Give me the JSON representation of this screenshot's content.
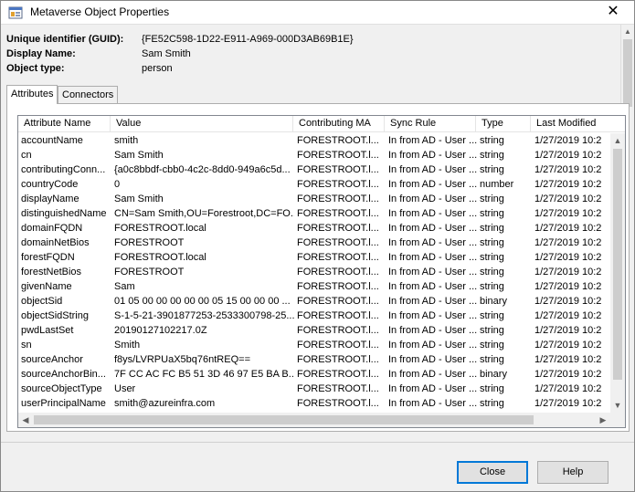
{
  "window": {
    "title": "Metaverse Object Properties",
    "close_glyph": "✕"
  },
  "info": {
    "guid_label": "Unique identifier (GUID):",
    "guid_value": "{FE52C598-1D22-E911-A969-000D3AB69B1E}",
    "display_name_label": "Display Name:",
    "display_name_value": "Sam Smith",
    "object_type_label": "Object type:",
    "object_type_value": "person"
  },
  "tabs": [
    {
      "label": "Attributes",
      "active": true
    },
    {
      "label": "Connectors",
      "active": false
    }
  ],
  "columns": [
    "Attribute Name",
    "Value",
    "Contributing MA",
    "Sync Rule",
    "Type",
    "Last Modified"
  ],
  "rows": [
    [
      "accountName",
      "smith",
      "FORESTROOT.l...",
      "In from AD - User ...",
      "string",
      "1/27/2019 10:2"
    ],
    [
      "cn",
      "Sam Smith",
      "FORESTROOT.l...",
      "In from AD - User ...",
      "string",
      "1/27/2019 10:2"
    ],
    [
      "contributingConn...",
      "{a0c8bbdf-cbb0-4c2c-8dd0-949a6c5d...",
      "FORESTROOT.l...",
      "In from AD - User ...",
      "string",
      "1/27/2019 10:2"
    ],
    [
      "countryCode",
      "0",
      "FORESTROOT.l...",
      "In from AD - User ...",
      "number",
      "1/27/2019 10:2"
    ],
    [
      "displayName",
      "Sam Smith",
      "FORESTROOT.l...",
      "In from AD - User ...",
      "string",
      "1/27/2019 10:2"
    ],
    [
      "distinguishedName",
      "CN=Sam Smith,OU=Forestroot,DC=FO...",
      "FORESTROOT.l...",
      "In from AD - User ...",
      "string",
      "1/27/2019 10:2"
    ],
    [
      "domainFQDN",
      "FORESTROOT.local",
      "FORESTROOT.l...",
      "In from AD - User ...",
      "string",
      "1/27/2019 10:2"
    ],
    [
      "domainNetBios",
      "FORESTROOT",
      "FORESTROOT.l...",
      "In from AD - User ...",
      "string",
      "1/27/2019 10:2"
    ],
    [
      "forestFQDN",
      "FORESTROOT.local",
      "FORESTROOT.l...",
      "In from AD - User ...",
      "string",
      "1/27/2019 10:2"
    ],
    [
      "forestNetBios",
      "FORESTROOT",
      "FORESTROOT.l...",
      "In from AD - User ...",
      "string",
      "1/27/2019 10:2"
    ],
    [
      "givenName",
      "Sam",
      "FORESTROOT.l...",
      "In from AD - User ...",
      "string",
      "1/27/2019 10:2"
    ],
    [
      "objectSid",
      "01 05 00 00 00 00 00 05 15 00 00 00 ...",
      "FORESTROOT.l...",
      "In from AD - User ...",
      "binary",
      "1/27/2019 10:2"
    ],
    [
      "objectSidString",
      "S-1-5-21-3901877253-2533300798-25...",
      "FORESTROOT.l...",
      "In from AD - User ...",
      "string",
      "1/27/2019 10:2"
    ],
    [
      "pwdLastSet",
      "20190127102217.0Z",
      "FORESTROOT.l...",
      "In from AD - User ...",
      "string",
      "1/27/2019 10:2"
    ],
    [
      "sn",
      "Smith",
      "FORESTROOT.l...",
      "In from AD - User ...",
      "string",
      "1/27/2019 10:2"
    ],
    [
      "sourceAnchor",
      "f8ys/LVRPUaX5bq76ntREQ==",
      "FORESTROOT.l...",
      "In from AD - User ...",
      "string",
      "1/27/2019 10:2"
    ],
    [
      "sourceAnchorBin...",
      "7F CC AC FC B5 51 3D 46 97 E5 BA B...",
      "FORESTROOT.l...",
      "In from AD - User ...",
      "binary",
      "1/27/2019 10:2"
    ],
    [
      "sourceObjectType",
      "User",
      "FORESTROOT.l...",
      "In from AD - User ...",
      "string",
      "1/27/2019 10:2"
    ],
    [
      "userPrincipalName",
      "smith@azureinfra.com",
      "FORESTROOT.l...",
      "In from AD - User ...",
      "string",
      "1/27/2019 10:2"
    ]
  ],
  "buttons": {
    "close_label": "Close",
    "help_label": "Help"
  },
  "icons": {
    "title": "properties-window-icon",
    "scroll_up": "chevron-up-icon",
    "scroll_down": "chevron-down-icon",
    "scroll_left": "chevron-left-icon",
    "scroll_right": "chevron-right-icon"
  }
}
